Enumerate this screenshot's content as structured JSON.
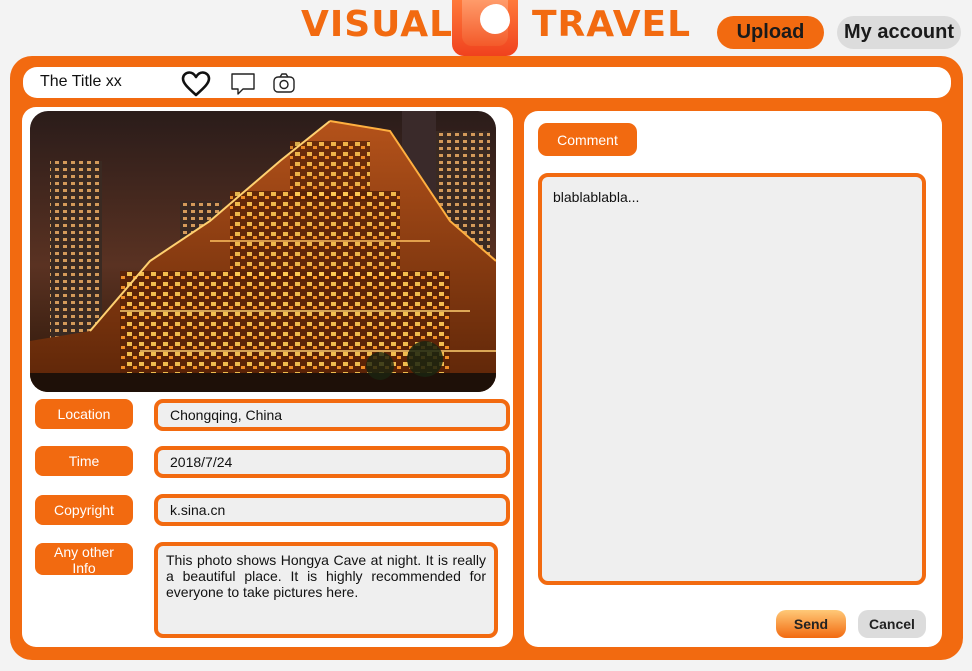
{
  "header": {
    "logo_left": "VISUAL",
    "logo_right": "TRAVEL",
    "upload_label": "Upload",
    "account_label": "My account"
  },
  "photo_card": {
    "title": "The Title xx",
    "icons": [
      "heart-icon",
      "chat-icon",
      "camera-icon"
    ]
  },
  "details": {
    "location_label": "Location",
    "location_value": "Chongqing, China",
    "time_label": "Time",
    "time_value": "2018/7/24",
    "copyright_label": "Copyright",
    "copyright_value": "k.sina.cn",
    "info_label": "Any other Info",
    "info_value": "This photo shows Hongya Cave at night. It is really a beautiful place. It is highly recommended for everyone to take pictures here."
  },
  "comments": {
    "comment_label": "Comment",
    "comment_text": "blablablabla...",
    "send_label": "Send",
    "cancel_label": "Cancel"
  },
  "colors": {
    "accent": "#f26a10",
    "panel": "#ffffff",
    "field_bg": "#efefef",
    "secondary_button": "#dcdcdc"
  }
}
